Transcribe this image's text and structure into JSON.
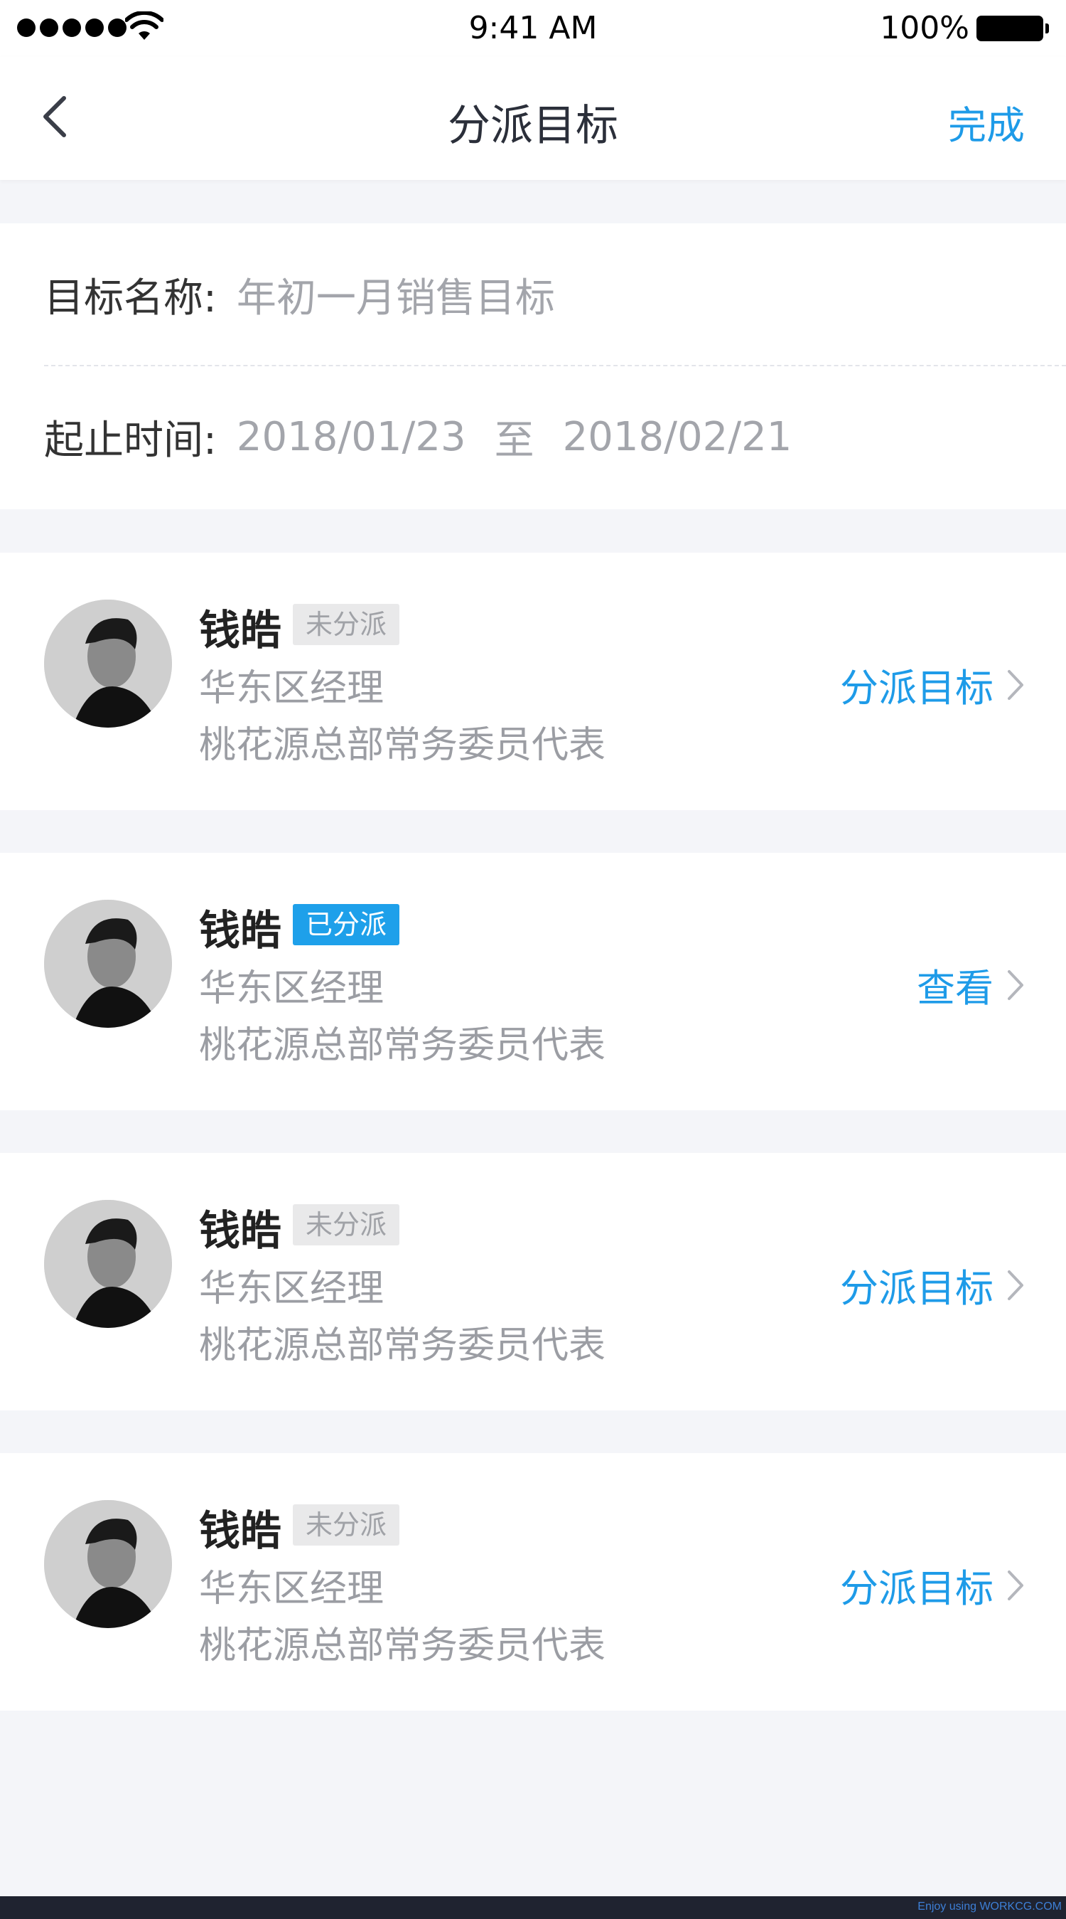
{
  "status_bar": {
    "time": "9:41 AM",
    "battery": "100%",
    "icons": [
      "signal-dots",
      "wifi-icon",
      "battery-icon"
    ]
  },
  "nav": {
    "title": "分派目标",
    "done_label": "完成",
    "back_icon": "chevron-left-icon"
  },
  "target": {
    "name_label": "目标名称:",
    "name_value": "年初一月销售目标",
    "period_label": "起止时间:",
    "start_date": "2018/01/23",
    "separator": "至",
    "end_date": "2018/02/21"
  },
  "members": [
    {
      "name": "钱皓",
      "status": "未分派",
      "title": "华东区经理",
      "dept": "桃花源总部常务委员代表",
      "action": "分派目标"
    },
    {
      "name": "钱皓",
      "status": "已分派",
      "title": "华东区经理",
      "dept": "桃花源总部常务委员代表",
      "action": "查看"
    },
    {
      "name": "钱皓",
      "status": "未分派",
      "title": "华东区经理",
      "dept": "桃花源总部常务委员代表",
      "action": "分派目标"
    },
    {
      "name": "钱皓",
      "status": "未分派",
      "title": "华东区经理",
      "dept": "桃花源总部常务委员代表",
      "action": "分派目标"
    }
  ],
  "colors": {
    "accent": "#1e9be8",
    "badge_assigned": "#1ea0ea",
    "badge_unassigned": "#e9e9ea",
    "background": "#f4f5f9"
  },
  "footer": {
    "watermark": "Enjoy using WORKCG.COM"
  }
}
